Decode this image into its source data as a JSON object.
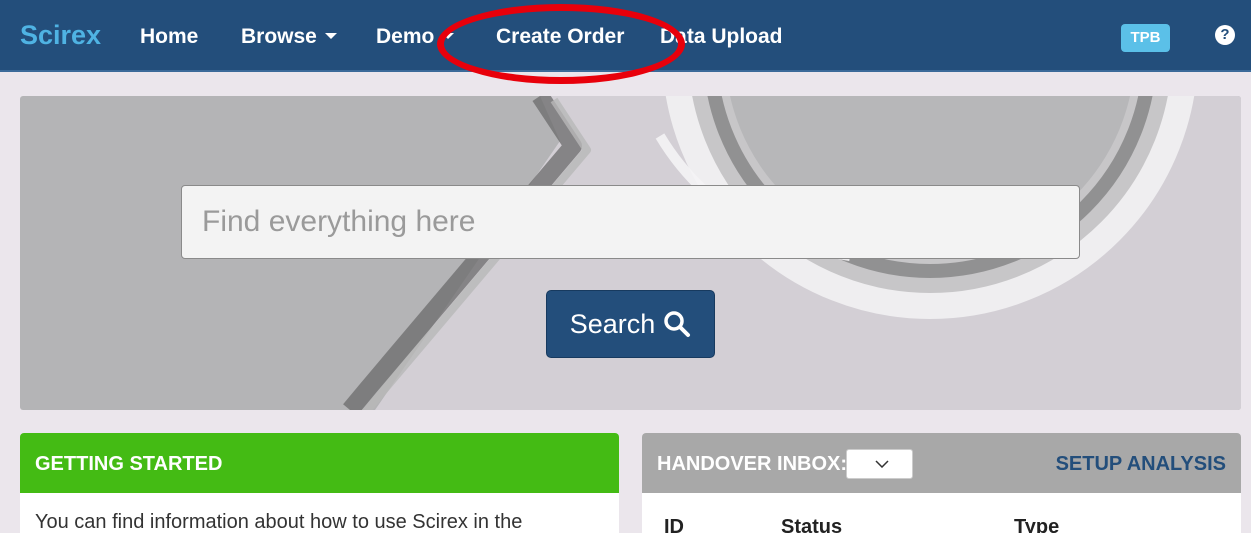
{
  "navbar": {
    "brand": "Scirex",
    "items": [
      {
        "label": "Home"
      },
      {
        "label": "Browse"
      },
      {
        "label": "Demo"
      },
      {
        "label": "Create Order"
      },
      {
        "label": "Data Upload"
      }
    ],
    "user_badge": "TPB",
    "help_glyph": "?"
  },
  "search": {
    "placeholder": "Find everything here",
    "button_label": "Search",
    "button_icon": "search-icon"
  },
  "getting_started": {
    "title": "GETTING STARTED",
    "text": "You can find information about how to use Scirex in the"
  },
  "handover_inbox": {
    "title": "HANDOVER INBOX:",
    "setup_link": "SETUP ANALYSIS",
    "columns": [
      "ID",
      "Status",
      "Type"
    ]
  },
  "colors": {
    "navbar": "#234e7b",
    "brand": "#4fb3e3",
    "getting_started_header": "#44bb14",
    "handover_header": "#a8a8a8",
    "annotation": "#e8000b"
  }
}
